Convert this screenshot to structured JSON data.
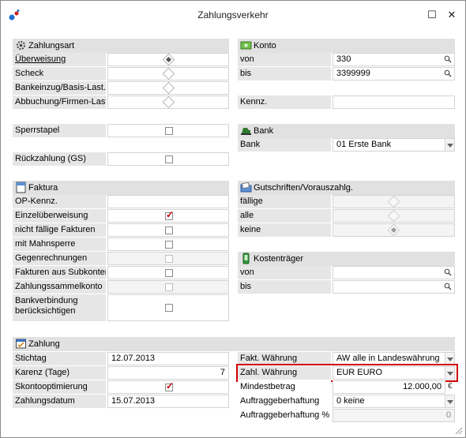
{
  "window": {
    "title": "Zahlungsverkehr",
    "maximize_glyph": "☐",
    "close_glyph": "✕"
  },
  "zahlungsart": {
    "title": "Zahlungsart",
    "options": [
      {
        "label": "Überweisung",
        "selected": true
      },
      {
        "label": "Scheck",
        "selected": false
      },
      {
        "label": "Bankeinzug/Basis-Last.",
        "selected": false
      },
      {
        "label": "Abbuchung/Firmen-Last.",
        "selected": false
      }
    ],
    "sperrstapel_label": "Sperrstapel",
    "rueckzahlung_label": "Rückzahlung (GS)"
  },
  "konto": {
    "title": "Konto",
    "von_label": "von",
    "von_value": "330",
    "bis_label": "bis",
    "bis_value": "3399999",
    "kennz_label": "Kennz.",
    "kennz_value": ""
  },
  "bank": {
    "title": "Bank",
    "label": "Bank",
    "value": "01   Erste Bank"
  },
  "faktura": {
    "title": "Faktura",
    "op_label": "OP-Kennz.",
    "items": [
      {
        "label": "Einzelüberweisung",
        "checked": true
      },
      {
        "label": "nicht fällige Fakturen",
        "checked": false
      },
      {
        "label": "mit Mahnsperre",
        "checked": false
      },
      {
        "label": "Gegenrechnungen",
        "checked": false
      },
      {
        "label": "Fakturen aus Subkonten",
        "checked": false
      },
      {
        "label": "Zahlungssammelkonto",
        "checked": false
      },
      {
        "label": "Bankverbindung berücksichtigen",
        "checked": false
      }
    ]
  },
  "gutschriften": {
    "title": "Gutschriften/Vorauszahlg.",
    "options": [
      {
        "label": "fällige",
        "selected": false
      },
      {
        "label": "alle",
        "selected": false
      },
      {
        "label": "keine",
        "selected": true
      }
    ]
  },
  "kostentraeger": {
    "title": "Kostenträger",
    "von_label": "von",
    "bis_label": "bis"
  },
  "zahlung": {
    "title": "Zahlung",
    "stichtag_label": "Stichtag",
    "stichtag_value": "12.07.2013",
    "karenz_label": "Karenz (Tage)",
    "karenz_value": "7",
    "skonto_label": "Skontooptimierung",
    "skonto_checked": true,
    "zahlungsdatum_label": "Zahlungsdatum",
    "zahlungsdatum_value": "15.07.2013",
    "fakt_label": "Fakt. Währung",
    "fakt_value": "AW   alle in Landeswährung",
    "zahl_label": "Zahl. Währung",
    "zahl_value": "EUR  EURO",
    "mindest_label": "Mindestbetrag",
    "mindest_value": "12.000,00",
    "mindest_unit": "€",
    "auftrag_label": "Auftraggeberhaftung",
    "auftrag_value": "0 keine",
    "auftrag_pct_label": "Auftraggeberhaftung %",
    "auftrag_pct_value": "0"
  },
  "colors": {
    "highlight": "#d00000",
    "check": "#c00000"
  }
}
